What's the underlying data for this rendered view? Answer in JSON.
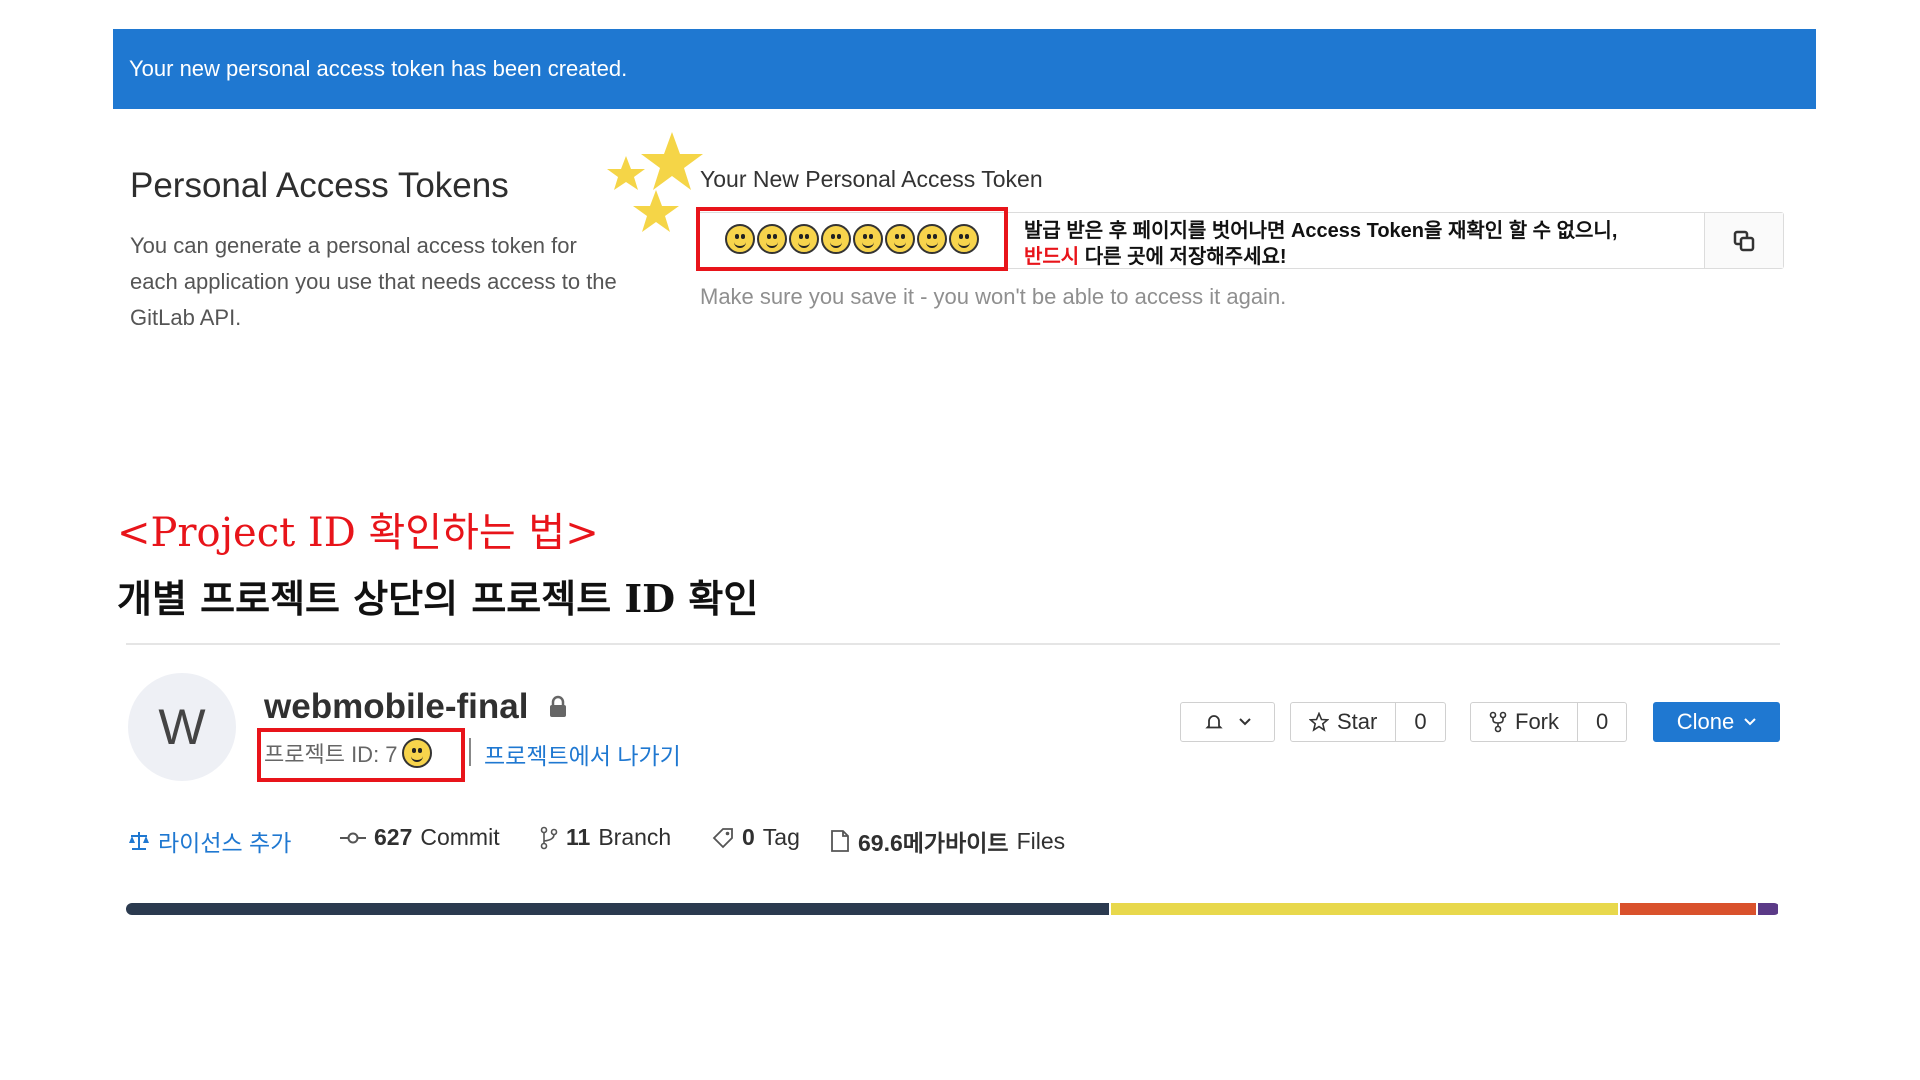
{
  "banner": {
    "text": "Your new personal access token has been created."
  },
  "pat": {
    "title": "Personal Access Tokens",
    "description": "You can generate a personal access token for each application you use that needs access to the GitLab API.",
    "new_token_label": "Your New Personal Access Token",
    "warning": "Make sure you save it - you won't be able to access it again.",
    "copy_icon": "copy-icon"
  },
  "annotation": {
    "line1": "발급 받은 후 페이지를 벗어나면 Access Token을 재확인 할 수 없으니,",
    "line2_red": "반드시",
    "line2_rest": " 다른 곳에 저장해주세요!"
  },
  "howto": {
    "title": "<Project ID 확인하는 법>",
    "subtitle": "개별 프로젝트 상단의 프로젝트 ID 확인"
  },
  "project": {
    "avatar_letter": "W",
    "name": "webmobile-final",
    "id_label": "프로젝트 ID: 7",
    "leave_link": "프로젝트에서 나가기",
    "notifications_icon": "bell-icon",
    "star_label": "Star",
    "star_count": "0",
    "fork_label": "Fork",
    "fork_count": "0",
    "clone_label": "Clone"
  },
  "stats": {
    "license": "라이선스 추가",
    "commit_count": "627",
    "commit_label": "Commit",
    "branch_count": "11",
    "branch_label": "Branch",
    "tag_count": "0",
    "tag_label": "Tag",
    "size": "69.6메가바이트",
    "files_label": "Files"
  },
  "language_bar": [
    {
      "color": "#2b3a4f",
      "fraction": 0.597
    },
    {
      "color": "#e8d84c",
      "fraction": 0.308
    },
    {
      "color": "#d9512c",
      "fraction": 0.083
    },
    {
      "color": "#5b3a87",
      "fraction": 0.012
    }
  ],
  "colors": {
    "accent": "#1f78d1",
    "highlight": "#e8141a"
  }
}
